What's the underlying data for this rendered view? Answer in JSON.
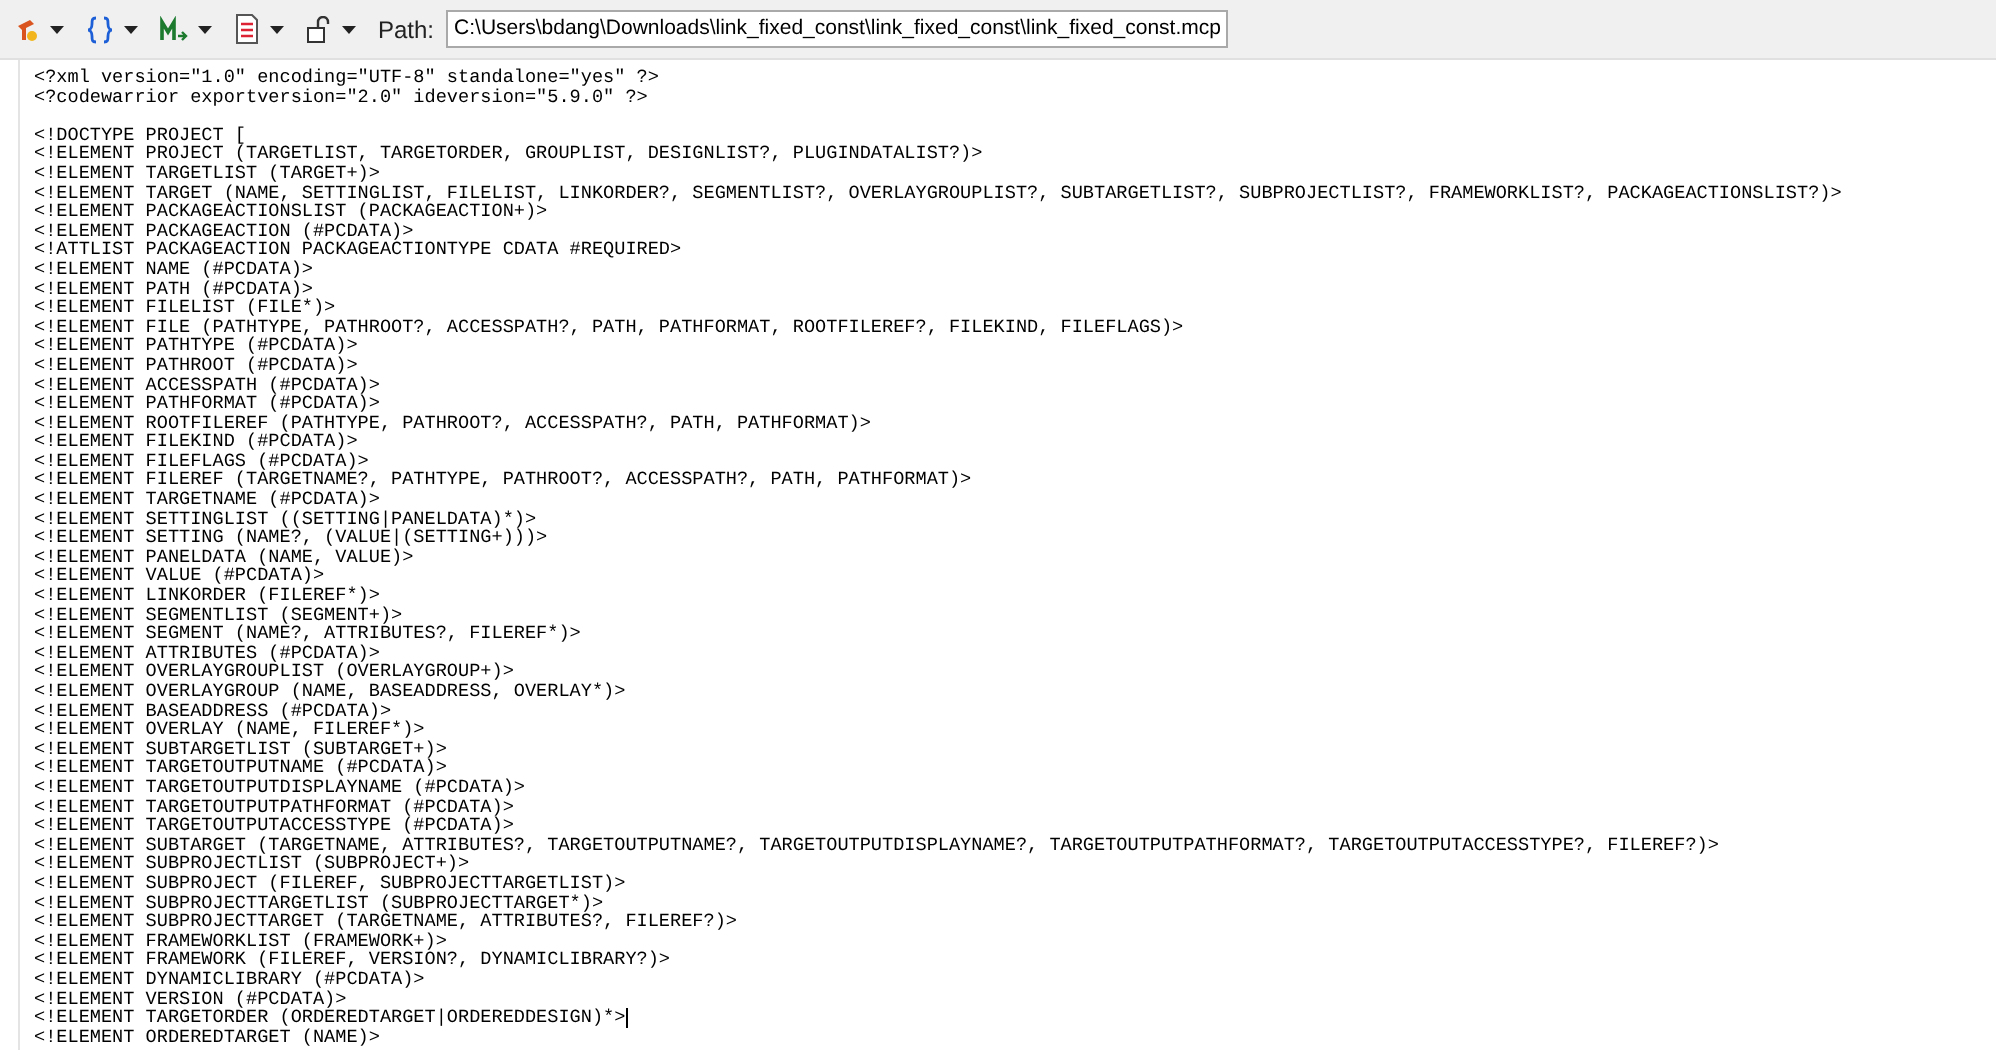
{
  "toolbar": {
    "buttons": [
      {
        "kind": "build",
        "dropdown": true
      },
      {
        "kind": "braces",
        "dropdown": true
      },
      {
        "kind": "macro",
        "dropdown": true
      },
      {
        "kind": "document",
        "dropdown": true
      },
      {
        "kind": "lock",
        "dropdown": true
      }
    ],
    "path_label": "Path:",
    "path_value": "C:\\Users\\bdang\\Downloads\\link_fixed_const\\link_fixed_const\\link_fixed_const.mcp"
  },
  "editor": {
    "lines": [
      {
        "kind": "code",
        "text": "<?xml version=\"1.0\" encoding=\"UTF-8\" standalone=\"yes\" ?>",
        "cursor": false
      },
      {
        "kind": "code",
        "text": "<?codewarrior exportversion=\"2.0\" ideversion=\"5.9.0\" ?>",
        "cursor": false
      },
      {
        "kind": "blank",
        "cursor": false
      },
      {
        "kind": "code",
        "text": "<!DOCTYPE PROJECT [",
        "cursor": false
      },
      {
        "kind": "code",
        "text": "<!ELEMENT PROJECT (TARGETLIST, TARGETORDER, GROUPLIST, DESIGNLIST?, PLUGINDATALIST?)>",
        "cursor": false
      },
      {
        "kind": "code",
        "text": "<!ELEMENT TARGETLIST (TARGET+)>",
        "cursor": false
      },
      {
        "kind": "code",
        "text": "<!ELEMENT TARGET (NAME, SETTINGLIST, FILELIST, LINKORDER?, SEGMENTLIST?, OVERLAYGROUPLIST?, SUBTARGETLIST?, SUBPROJECTLIST?, FRAMEWORKLIST?, PACKAGEACTIONSLIST?)>",
        "cursor": false
      },
      {
        "kind": "code",
        "text": "<!ELEMENT PACKAGEACTIONSLIST (PACKAGEACTION+)>",
        "cursor": false
      },
      {
        "kind": "code",
        "text": "<!ELEMENT PACKAGEACTION (#PCDATA)>",
        "cursor": false
      },
      {
        "kind": "code",
        "text": "<!ATTLIST PACKAGEACTION PACKAGEACTIONTYPE CDATA #REQUIRED>",
        "cursor": false
      },
      {
        "kind": "code",
        "text": "<!ELEMENT NAME (#PCDATA)>",
        "cursor": false
      },
      {
        "kind": "code",
        "text": "<!ELEMENT PATH (#PCDATA)>",
        "cursor": false
      },
      {
        "kind": "code",
        "text": "<!ELEMENT FILELIST (FILE*)>",
        "cursor": false
      },
      {
        "kind": "code",
        "text": "<!ELEMENT FILE (PATHTYPE, PATHROOT?, ACCESSPATH?, PATH, PATHFORMAT, ROOTFILEREF?, FILEKIND, FILEFLAGS)>",
        "cursor": false
      },
      {
        "kind": "code",
        "text": "<!ELEMENT PATHTYPE (#PCDATA)>",
        "cursor": false
      },
      {
        "kind": "code",
        "text": "<!ELEMENT PATHROOT (#PCDATA)>",
        "cursor": false
      },
      {
        "kind": "code",
        "text": "<!ELEMENT ACCESSPATH (#PCDATA)>",
        "cursor": false
      },
      {
        "kind": "code",
        "text": "<!ELEMENT PATHFORMAT (#PCDATA)>",
        "cursor": false
      },
      {
        "kind": "code",
        "text": "<!ELEMENT ROOTFILEREF (PATHTYPE, PATHROOT?, ACCESSPATH?, PATH, PATHFORMAT)>",
        "cursor": false
      },
      {
        "kind": "code",
        "text": "<!ELEMENT FILEKIND (#PCDATA)>",
        "cursor": false
      },
      {
        "kind": "code",
        "text": "<!ELEMENT FILEFLAGS (#PCDATA)>",
        "cursor": false
      },
      {
        "kind": "code",
        "text": "<!ELEMENT FILEREF (TARGETNAME?, PATHTYPE, PATHROOT?, ACCESSPATH?, PATH, PATHFORMAT)>",
        "cursor": false
      },
      {
        "kind": "code",
        "text": "<!ELEMENT TARGETNAME (#PCDATA)>",
        "cursor": false
      },
      {
        "kind": "code",
        "text": "<!ELEMENT SETTINGLIST ((SETTING|PANELDATA)*)>",
        "cursor": false
      },
      {
        "kind": "code",
        "text": "<!ELEMENT SETTING (NAME?, (VALUE|(SETTING+)))>",
        "cursor": false
      },
      {
        "kind": "code",
        "text": "<!ELEMENT PANELDATA (NAME, VALUE)>",
        "cursor": false
      },
      {
        "kind": "code",
        "text": "<!ELEMENT VALUE (#PCDATA)>",
        "cursor": false
      },
      {
        "kind": "code",
        "text": "<!ELEMENT LINKORDER (FILEREF*)>",
        "cursor": false
      },
      {
        "kind": "code",
        "text": "<!ELEMENT SEGMENTLIST (SEGMENT+)>",
        "cursor": false
      },
      {
        "kind": "code",
        "text": "<!ELEMENT SEGMENT (NAME?, ATTRIBUTES?, FILEREF*)>",
        "cursor": false
      },
      {
        "kind": "code",
        "text": "<!ELEMENT ATTRIBUTES (#PCDATA)>",
        "cursor": false
      },
      {
        "kind": "code",
        "text": "<!ELEMENT OVERLAYGROUPLIST (OVERLAYGROUP+)>",
        "cursor": false
      },
      {
        "kind": "code",
        "text": "<!ELEMENT OVERLAYGROUP (NAME, BASEADDRESS, OVERLAY*)>",
        "cursor": false
      },
      {
        "kind": "code",
        "text": "<!ELEMENT BASEADDRESS (#PCDATA)>",
        "cursor": false
      },
      {
        "kind": "code",
        "text": "<!ELEMENT OVERLAY (NAME, FILEREF*)>",
        "cursor": false
      },
      {
        "kind": "code",
        "text": "<!ELEMENT SUBTARGETLIST (SUBTARGET+)>",
        "cursor": false
      },
      {
        "kind": "code",
        "text": "<!ELEMENT TARGETOUTPUTNAME (#PCDATA)>",
        "cursor": false
      },
      {
        "kind": "code",
        "text": "<!ELEMENT TARGETOUTPUTDISPLAYNAME (#PCDATA)>",
        "cursor": false
      },
      {
        "kind": "code",
        "text": "<!ELEMENT TARGETOUTPUTPATHFORMAT (#PCDATA)>",
        "cursor": false
      },
      {
        "kind": "code",
        "text": "<!ELEMENT TARGETOUTPUTACCESSTYPE (#PCDATA)>",
        "cursor": false
      },
      {
        "kind": "code",
        "text": "<!ELEMENT SUBTARGET (TARGETNAME, ATTRIBUTES?, TARGETOUTPUTNAME?, TARGETOUTPUTDISPLAYNAME?, TARGETOUTPUTPATHFORMAT?, TARGETOUTPUTACCESSTYPE?, FILEREF?)>",
        "cursor": false
      },
      {
        "kind": "code",
        "text": "<!ELEMENT SUBPROJECTLIST (SUBPROJECT+)>",
        "cursor": false
      },
      {
        "kind": "code",
        "text": "<!ELEMENT SUBPROJECT (FILEREF, SUBPROJECTTARGETLIST)>",
        "cursor": false
      },
      {
        "kind": "code",
        "text": "<!ELEMENT SUBPROJECTTARGETLIST (SUBPROJECTTARGET*)>",
        "cursor": false
      },
      {
        "kind": "code",
        "text": "<!ELEMENT SUBPROJECTTARGET (TARGETNAME, ATTRIBUTES?, FILEREF?)>",
        "cursor": false
      },
      {
        "kind": "code",
        "text": "<!ELEMENT FRAMEWORKLIST (FRAMEWORK+)>",
        "cursor": false
      },
      {
        "kind": "code",
        "text": "<!ELEMENT FRAMEWORK (FILEREF, VERSION?, DYNAMICLIBRARY?)>",
        "cursor": false
      },
      {
        "kind": "code",
        "text": "<!ELEMENT DYNAMICLIBRARY (#PCDATA)>",
        "cursor": false
      },
      {
        "kind": "code",
        "text": "<!ELEMENT VERSION (#PCDATA)>",
        "cursor": false
      },
      {
        "kind": "code",
        "text": "<!ELEMENT TARGETORDER (ORDEREDTARGET|ORDEREDDESIGN)*>",
        "cursor": true
      },
      {
        "kind": "code",
        "text": "<!ELEMENT ORDEREDTARGET (NAME)>",
        "cursor": false
      }
    ]
  }
}
